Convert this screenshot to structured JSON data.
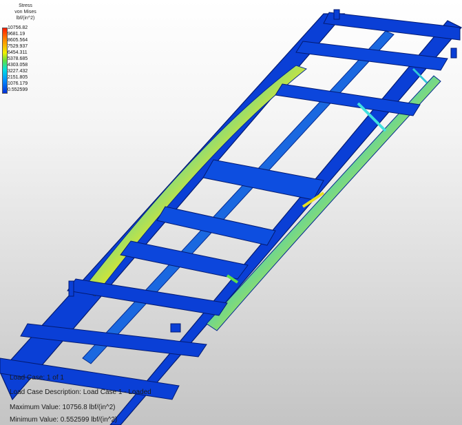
{
  "legend": {
    "title_lines": [
      "Stress",
      "von Mises",
      "lbf/(in^2)"
    ],
    "ticks": [
      "10756.82",
      "9681.19",
      "8605.564",
      "7529.937",
      "6454.311",
      "5378.685",
      "4303.058",
      "3227.432",
      "2151.805",
      "1076.179",
      "0.552599"
    ]
  },
  "info": {
    "load_case": "Load Case: 1 of 1",
    "load_case_description": "Load Case Description: Load Case 1 - Loaded",
    "maximum_value": "Maximum Value: 10756.8 lbf/(in^2)",
    "minimum_value": "Minimum Value: 0.552599 lbf/(in^2)"
  },
  "colors": {
    "frame_blue": "#0a3fd6",
    "frame_dark": "#0527a0",
    "stress_cyan": "#1fd0d0",
    "stress_green": "#5fe04a",
    "stress_yellow": "#f0f020",
    "stress_orange": "#ff9a1a"
  }
}
